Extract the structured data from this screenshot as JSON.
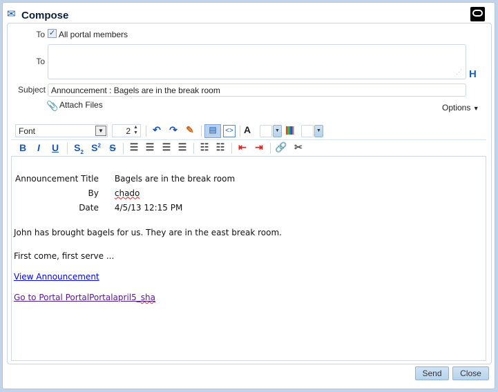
{
  "dialog": {
    "title": "Compose",
    "icon": "compose-mail-icon",
    "logo": "oracle-logo"
  },
  "form": {
    "to_label": "To",
    "all_members_label": "All portal members",
    "all_members_checked": true,
    "to2_label": "To",
    "to_value": "",
    "subject_label": "Subject",
    "subject_value": "Announcement : Bagels are in the break room",
    "attach_label": "Attach Files",
    "options_label": "Options"
  },
  "toolbar": {
    "font_value": "Font",
    "size_value": "2",
    "row2": {
      "bold": "B",
      "italic": "I",
      "underline": "U"
    }
  },
  "message": {
    "rows": [
      {
        "label": "Announcement Title",
        "value": "Bagels are in the break room"
      },
      {
        "label": "By",
        "value": "chado"
      },
      {
        "label": "Date",
        "value": "4/5/13 12:15 PM"
      }
    ],
    "paragraph1": "John has brought bagels for us. They are in the east break room.",
    "paragraph2": "First come, first serve ...",
    "link1": "View Announcement",
    "link2_prefix": "Go to Portal PortalPortalapril5_",
    "link2_suffix": "sha"
  },
  "footer": {
    "send": "Send",
    "close": "Close"
  },
  "colors": {
    "accent": "#1a56b5",
    "link": "#0000ee",
    "visited": "#551a8b"
  }
}
